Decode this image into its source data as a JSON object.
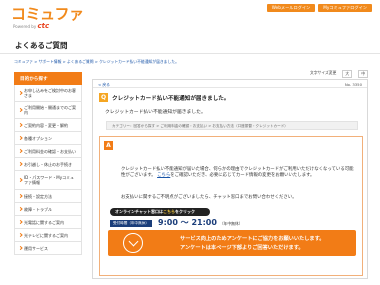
{
  "header": {
    "logo_main": "コミュファ",
    "logo_powered": "Powered by",
    "logo_brand": "ctc",
    "links": [
      "Webメールログイン",
      "Myコミュファログイン"
    ]
  },
  "page_title": "よくあるご質問",
  "breadcrumb": {
    "trail": "コミュファ > サポート情報 > よくあるご質問 > クレジットカード払い不能通知が届きました。",
    "current": "クレジットカード払い不能通知が届きました。"
  },
  "sidebar": {
    "heading": "目的から探す",
    "items": [
      "お申し込みをご検討中のお客さま",
      "ご利用開始・開通までのご案内",
      "ご契約内容・変更・解約",
      "各種オプション",
      "ご利用料金の確認・お支払い",
      "お引越し・休止のお手続き",
      "ID・パスワード・Myコミュファ情報",
      "接続・設定方法",
      "故障・トラブル",
      "光電話に関するご案内",
      "光テレビに関するご案内",
      "運用サービス"
    ]
  },
  "main": {
    "util_font_label": "文字サイズ変更",
    "util_font_sizes": [
      "大",
      "中"
    ],
    "back_link": "< 戻る",
    "faq_no": "No. 3350",
    "question_badge": "Q",
    "question_title": "クレジットカード払い不能通知が届きました。",
    "question_body": "クレジットカード払い不能通知が届きました。",
    "category_path": "カテゴリー：回答から探す > ご利用料金の確認・お支払い > お支払い方法（口座振替・クレジットカード）",
    "answer_badge": "A",
    "answer_line1": "クレジットカード払い不能通知が届いた場合、何らかの理由でクレジットカードがご利用いただけなくなっている可能性がございます。",
    "answer_link": "こちら",
    "answer_line1_tail": "をご確認いただき、必要に応じてカード情報の変更をお願いいたします。",
    "answer_line2": "お支払いに関するご不明点がございましたら、チャット窓口までお問い合わせください。",
    "chat_button_prefix": "オンラインチャット窓口は",
    "chat_button_highlight": "こちら",
    "chat_button_suffix": "をクリック",
    "hours_label": "受付時間（年中無休）",
    "hours": "9:00 ～ 21:00",
    "hours_note": "（年中無休）",
    "survey_line1": "サービス向上のためアンケートにご協力をお願いいたします。",
    "survey_line2": "アンケートは本ページ下部よりご回答いただけます。"
  },
  "colors": {
    "brand_orange": "#f27c16",
    "link_blue": "#1a55a8",
    "navy": "#1a3d7a"
  }
}
